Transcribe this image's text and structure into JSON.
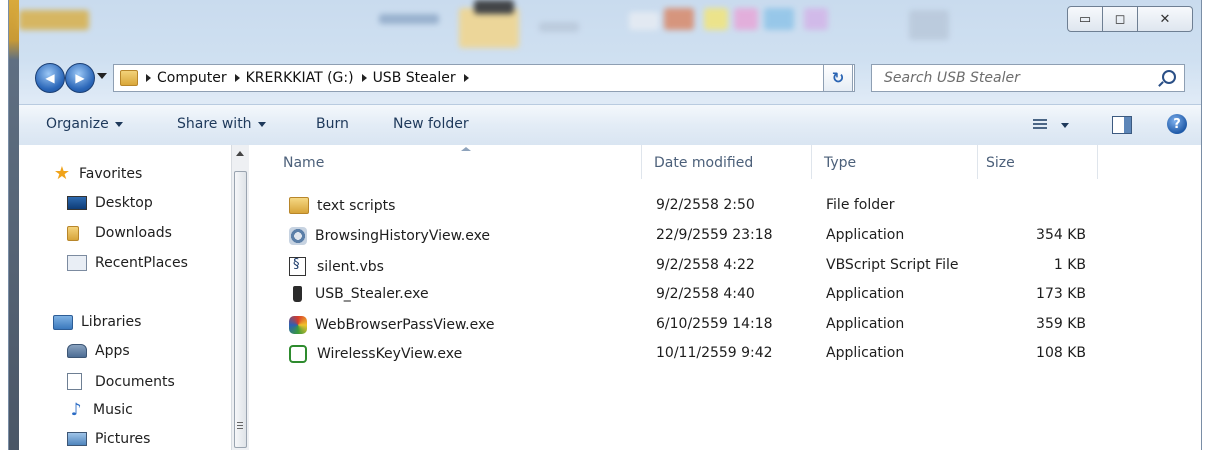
{
  "colors": {
    "accent": "#2a66b8",
    "command_text": "#1e395b",
    "header_text": "#4c607a"
  },
  "titlebar": {
    "minimize_icon": "minimize-icon",
    "maximize_icon": "maximize-icon",
    "close_icon": "close-icon",
    "minimize_glyph": "▭",
    "maximize_glyph": "◻",
    "close_glyph": "✕"
  },
  "address": {
    "back_glyph": "◀",
    "forward_glyph": "▶",
    "breadcrumb": [
      "Computer",
      "KRERKKIAT (G:)",
      "USB Stealer"
    ],
    "refresh_glyph": "↻"
  },
  "search": {
    "placeholder": "Search USB Stealer"
  },
  "toolbar": {
    "organize": "Organize",
    "share_with": "Share with",
    "burn": "Burn",
    "new_folder": "New folder",
    "help_glyph": "?"
  },
  "nav": {
    "favorites": {
      "label": "Favorites",
      "items": [
        "Desktop",
        "Downloads",
        "RecentPlaces"
      ]
    },
    "libraries": {
      "label": "Libraries",
      "items": [
        "Apps",
        "Documents",
        "Music",
        "Pictures"
      ]
    }
  },
  "files": {
    "columns": [
      "Name",
      "Date modified",
      "Type",
      "Size"
    ],
    "rows": [
      {
        "name": "text scripts",
        "date": "9/2/2558 2:50",
        "type": "File folder",
        "size": "",
        "icon": "folder-icon"
      },
      {
        "name": "BrowsingHistoryView.exe",
        "date": "22/9/2559 23:18",
        "type": "Application",
        "size": "354 KB",
        "icon": "browsing-history-app-icon"
      },
      {
        "name": "silent.vbs",
        "date": "9/2/2558 4:22",
        "type": "VBScript Script File",
        "size": "1 KB",
        "icon": "vbscript-file-icon"
      },
      {
        "name": "USB_Stealer.exe",
        "date": "9/2/2558 4:40",
        "type": "Application",
        "size": "173 KB",
        "icon": "usb-drive-icon"
      },
      {
        "name": "WebBrowserPassView.exe",
        "date": "6/10/2559 14:18",
        "type": "Application",
        "size": "359 KB",
        "icon": "web-browser-pass-app-icon"
      },
      {
        "name": "WirelessKeyView.exe",
        "date": "10/11/2559 9:42",
        "type": "Application",
        "size": "108 KB",
        "icon": "wireless-key-app-icon"
      }
    ]
  }
}
